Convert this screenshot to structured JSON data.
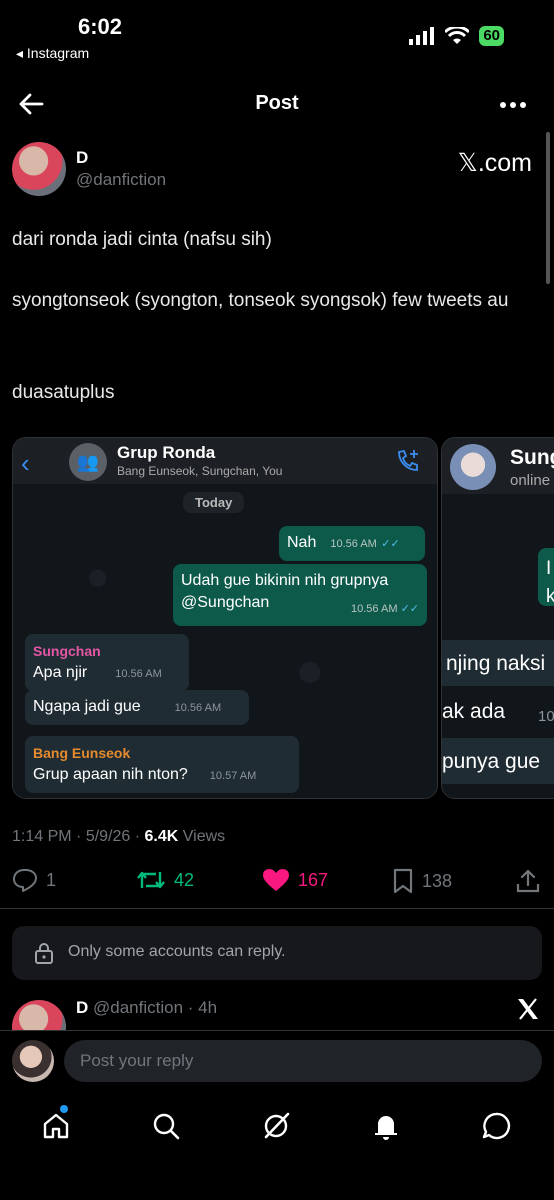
{
  "status_bar": {
    "time": "6:02",
    "back_app": "◂ Instagram",
    "battery": "60"
  },
  "header": {
    "title": "Post"
  },
  "author": {
    "name": "D",
    "handle": "@danfiction",
    "watermark": "𝕏.com"
  },
  "post": {
    "text1": "dari ronda jadi cinta (nafsu sih)",
    "text2": "syongtonseok (syongton, tonseok syongsok) few tweets au",
    "text3": "duasatuplus"
  },
  "chat1": {
    "group_name": "Grup Ronda",
    "members": "Bang Eunseok, Sungchan, You",
    "date_label": "Today",
    "messages": [
      {
        "text": "Nah",
        "time": "10.56 AM"
      },
      {
        "text": "Udah gue bikinin nih grupnya @Sungchan",
        "time": "10.56 AM"
      },
      {
        "sender": "Sungchan",
        "text": "Apa njir",
        "time": "10.56 AM"
      },
      {
        "text": "Ngapa jadi gue",
        "time": "10.56 AM"
      },
      {
        "sender": "Bang Eunseok",
        "text": "Grup apaan nih nton?",
        "time": "10.57 AM"
      }
    ]
  },
  "chat2": {
    "name": "Sung",
    "sub": "online",
    "frag1": "I",
    "frag2": "k",
    "frag3": "njing naksi",
    "frag4": "ak ada",
    "frag4_time": "10",
    "frag5": "punya gue"
  },
  "meta": {
    "time": "1:14 PM",
    "date": "5/9/26",
    "views_count": "6.4K",
    "views_label": "Views"
  },
  "actions": {
    "replies": "1",
    "reposts": "42",
    "likes": "167",
    "bookmarks": "138"
  },
  "reply_restriction": "Only some accounts can reply.",
  "reply_preview": {
    "name": "D",
    "handle": "@danfiction",
    "age": "· 4h"
  },
  "composer": {
    "placeholder": "Post your reply"
  },
  "colors": {
    "like": "#f91880",
    "repost": "#00ba7c",
    "accent": "#1d9bf0",
    "wa_out": "#0d5a4b",
    "wa_in": "#202c33"
  },
  "icons": [
    "back-arrow-icon",
    "more-icon",
    "reply-icon",
    "repost-icon",
    "heart-icon",
    "bookmark-icon",
    "share-icon",
    "lock-icon",
    "home-icon",
    "search-icon",
    "grok-icon",
    "bell-icon",
    "messages-icon",
    "x-logo-icon"
  ]
}
